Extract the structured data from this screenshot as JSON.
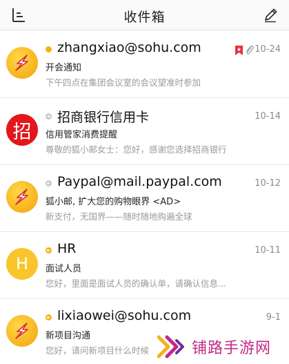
{
  "header": {
    "title": "收件箱",
    "menu_icon": "sidebar-menu-icon",
    "compose_icon": "pencil-icon"
  },
  "colors": {
    "accent": "#f6b20d",
    "flag": "#e8323c",
    "bank": "#e3161b"
  },
  "emails": [
    {
      "sender": "zhangxiao@sohu.com",
      "date": "10-24",
      "subject": "开会通知",
      "preview": "下午四点在集团会议室的会议望准时参加",
      "status": "unread",
      "avatar": "sohu",
      "flagged": true,
      "attachment": true
    },
    {
      "sender": "招商银行信用卡",
      "date": "10-14",
      "subject": "信用管家消费提醒",
      "preview": "尊敬的狐小邮女士：您好，感谢您选择招商银行",
      "status": "read-forward",
      "avatar": "cmb",
      "avatar_text": "招"
    },
    {
      "sender": "Paypal@mail.paypal.com",
      "date": "10-12",
      "subject": "狐小邮, 扩大您的购物眼界 <AD>",
      "preview": "新支付，无国界——随时随地购遍全球",
      "status": "read-reply",
      "avatar": "sohu"
    },
    {
      "sender": "HR",
      "date": "10-11",
      "subject": "面试人员",
      "preview": "您好，里面是面试人员的确认单，请确认信息...",
      "status": "reply",
      "avatar": "letter",
      "avatar_text": "H"
    },
    {
      "sender": "lixiaowei@sohu.com",
      "date": "9-1",
      "subject": "新项目沟通",
      "preview": "您好，请问新项目什么时候",
      "status": "reply",
      "avatar": "sohu"
    }
  ],
  "watermark": {
    "text": "铺路手游网"
  }
}
